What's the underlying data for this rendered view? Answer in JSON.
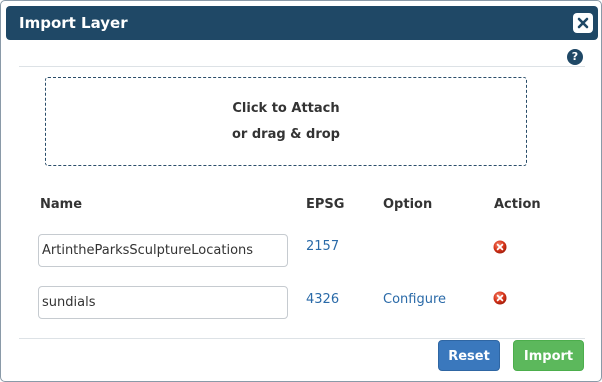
{
  "dialog": {
    "title": "Import Layer",
    "close_icon": "close-x-icon",
    "help_label": "?",
    "help_icon": "question-circle-icon"
  },
  "dropzone": {
    "line1": "Click to Attach",
    "line2": "or drag & drop"
  },
  "table": {
    "headers": {
      "name": "Name",
      "epsg": "EPSG",
      "option": "Option",
      "action": "Action"
    },
    "rows": [
      {
        "name": "ArtintheParksSculptureLocations",
        "epsg": "2157",
        "option": "",
        "action_icon": "delete-red-x-icon"
      },
      {
        "name": "sundials",
        "epsg": "4326",
        "option": "Configure",
        "action_icon": "delete-red-x-icon"
      }
    ]
  },
  "footer": {
    "reset_label": "Reset",
    "import_label": "Import"
  },
  "colors": {
    "titlebar": "#1f4866",
    "link": "#2a6aa8",
    "reset": "#3a78bd",
    "import": "#5cb85c",
    "delete": "#d9361c"
  }
}
